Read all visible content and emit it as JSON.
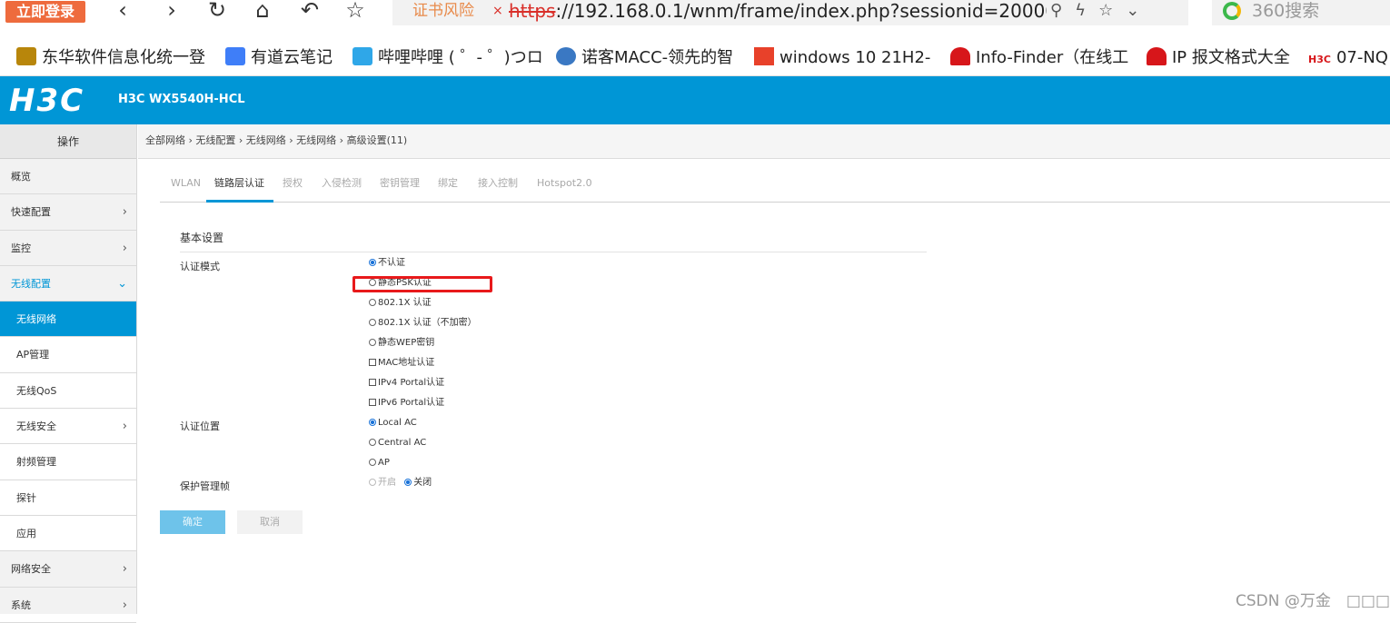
{
  "browser": {
    "login_label": "立即登录",
    "url_warning": "证书风险",
    "url_warning_x": "×",
    "url_protocol": "https",
    "url_rest": "://192.168.0.1/wnm/frame/index.php?sessionid=20000",
    "search_placeholder": "360搜索"
  },
  "bookmarks": [
    {
      "label": "东华软件信息化统一登",
      "icon_color": "#b8860b"
    },
    {
      "label": "有道云笔记",
      "icon_color": "#3f7ef8"
    },
    {
      "label": "哔哩哔哩 ( ゜- ゜)つロ",
      "icon_color": "#2fa7e8"
    },
    {
      "label": "诺客MACC-领先的智",
      "icon_color": "#3a78c3"
    },
    {
      "label": "windows 10 21H2-",
      "icon_color": "#e8412a"
    },
    {
      "label": "Info-Finder（在线工",
      "icon_color": "#d7161a"
    },
    {
      "label": "IP 报文格式大全",
      "icon_color": "#d7161a"
    },
    {
      "label": "07-NQ",
      "icon_color": "#d7161a",
      "icon_text": "H3C"
    }
  ],
  "header": {
    "logo": "H3C",
    "model": "H3C WX5540H-HCL",
    "bg_color": "#0096d6"
  },
  "sidebar": {
    "title": "操作",
    "items": [
      {
        "label": "概览",
        "type": "top"
      },
      {
        "label": "快速配置",
        "type": "top",
        "chevron": "›"
      },
      {
        "label": "监控",
        "type": "top",
        "chevron": "›"
      },
      {
        "label": "无线配置",
        "type": "open",
        "chevron": "⌄"
      },
      {
        "label": "无线网络",
        "type": "active"
      },
      {
        "label": "AP管理",
        "type": "sub"
      },
      {
        "label": "无线QoS",
        "type": "sub"
      },
      {
        "label": "无线安全",
        "type": "sub",
        "chevron": "›"
      },
      {
        "label": "射频管理",
        "type": "sub"
      },
      {
        "label": "探针",
        "type": "sub"
      },
      {
        "label": "应用",
        "type": "sub"
      },
      {
        "label": "网络安全",
        "type": "top",
        "chevron": "›"
      },
      {
        "label": "系统",
        "type": "top",
        "chevron": "›"
      }
    ]
  },
  "breadcrumb": "全部网络 › 无线配置 › 无线网络 › 无线网络 › 高级设置(11)",
  "tabs": [
    {
      "label": "WLAN",
      "active": false
    },
    {
      "label": "链路层认证",
      "active": true
    },
    {
      "label": "授权",
      "active": false
    },
    {
      "label": "入侵检测",
      "active": false
    },
    {
      "label": "密钥管理",
      "active": false
    },
    {
      "label": "绑定",
      "active": false
    },
    {
      "label": "接入控制",
      "active": false
    },
    {
      "label": "Hotspot2.0",
      "active": false
    }
  ],
  "form": {
    "section_title": "基本设置",
    "auth_mode_label": "认证模式",
    "auth_mode_options": [
      {
        "label": "不认证",
        "kind": "radio",
        "checked": true
      },
      {
        "label": "静态PSK认证",
        "kind": "radio",
        "checked": false
      },
      {
        "label": "802.1X 认证",
        "kind": "radio",
        "checked": false
      },
      {
        "label": "802.1X 认证（不加密）",
        "kind": "radio",
        "checked": false
      },
      {
        "label": "静态WEP密钥",
        "kind": "radio",
        "checked": false
      },
      {
        "label": "MAC地址认证",
        "kind": "checkbox",
        "checked": false
      },
      {
        "label": "IPv4 Portal认证",
        "kind": "checkbox",
        "checked": false
      },
      {
        "label": "IPv6 Portal认证",
        "kind": "checkbox",
        "checked": false
      }
    ],
    "auth_location_label": "认证位置",
    "auth_location_options": [
      {
        "label": "Local AC",
        "checked": true
      },
      {
        "label": "Central AC",
        "checked": false
      },
      {
        "label": "AP",
        "checked": false
      }
    ],
    "pmf_label": "保护管理帧",
    "pmf_on_label": "开启",
    "pmf_off_label": "关闭",
    "pmf_value": "关闭",
    "ok_label": "确定",
    "cancel_label": "取消",
    "highlight_color": "#e8191b"
  },
  "watermark": "CSDN @万金　□□□□"
}
